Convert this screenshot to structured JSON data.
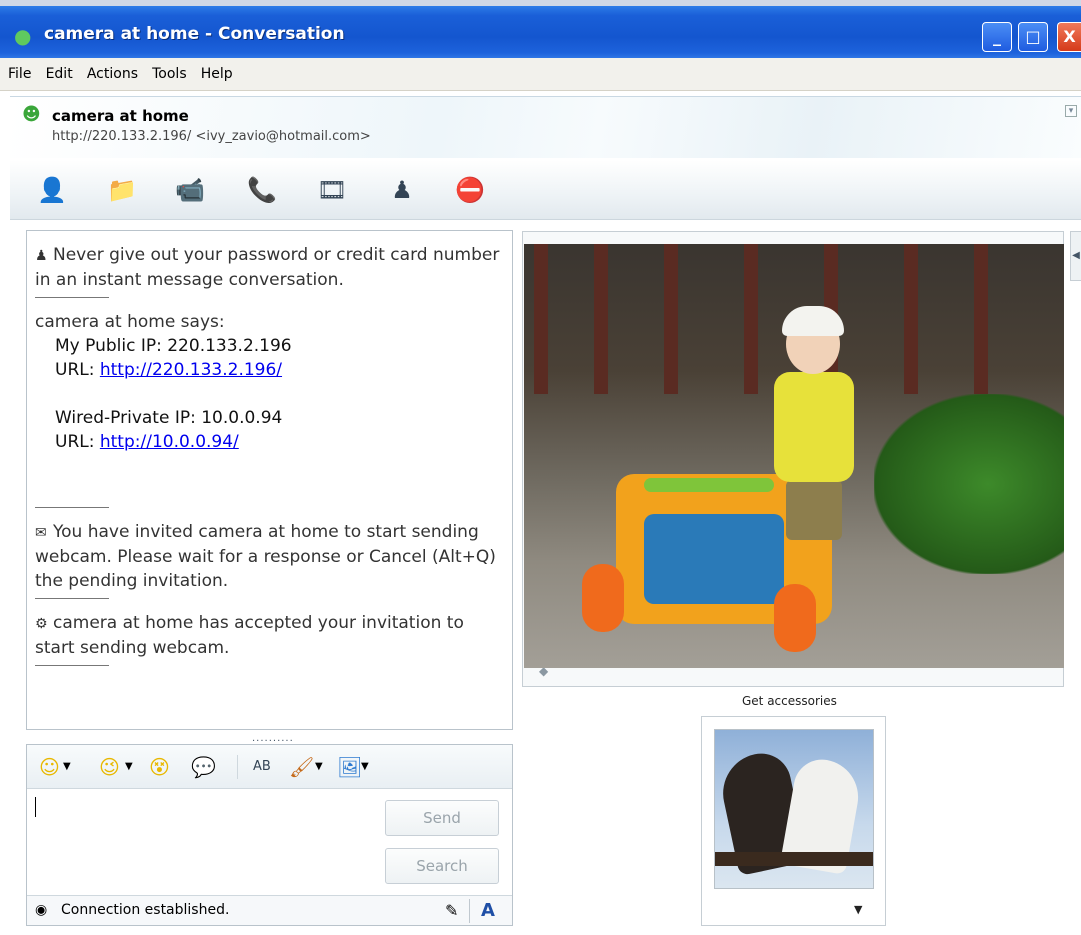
{
  "window": {
    "title": "camera at home - Conversation",
    "controls": {
      "minimize": "_",
      "maximize": "□",
      "close": "X"
    }
  },
  "menu": [
    "File",
    "Edit",
    "Actions",
    "Tools",
    "Help"
  ],
  "contact": {
    "name": "camera at home",
    "address": "http://220.133.2.196/ <ivy_zavio@hotmail.com>",
    "icon": "contact-online-icon"
  },
  "toolbar": [
    {
      "name": "invite-contact",
      "icon": "invite-contact-icon",
      "glyph": "👤"
    },
    {
      "name": "send-files",
      "icon": "send-files-icon",
      "glyph": "📁"
    },
    {
      "name": "start-webcam",
      "icon": "webcam-icon",
      "glyph": "📹"
    },
    {
      "name": "start-call",
      "icon": "phone-icon",
      "glyph": "📞"
    },
    {
      "name": "activities",
      "icon": "activities-icon",
      "glyph": "🎞"
    },
    {
      "name": "games",
      "icon": "games-icon",
      "glyph": "♟"
    },
    {
      "name": "block",
      "icon": "block-contact-icon",
      "glyph": "⛔"
    }
  ],
  "messages": {
    "warning": "Never give out your password or credit card number in an instant message conversation.",
    "sender": "camera at home says:",
    "public_ip": "My Public IP: 220.133.2.196",
    "url_label_1": "URL: ",
    "url_1": "http://220.133.2.196/",
    "private_ip": "Wired-Private IP: 10.0.0.94",
    "url_label_2": "URL: ",
    "url_2": "http://10.0.0.94/",
    "invite_notice": "You have invited camera at home to start sending webcam. Please wait for a response or Cancel (Alt+Q) the pending invitation.",
    "accepted_notice": "camera at home has accepted your invitation to start sending webcam."
  },
  "splitter": "..........",
  "compose": {
    "tools": [
      {
        "name": "emoticon",
        "glyph": "☺"
      },
      {
        "name": "wink",
        "glyph": "😉"
      },
      {
        "name": "nudge",
        "glyph": "😵"
      },
      {
        "name": "voice-clip",
        "glyph": "💬"
      },
      {
        "name": "font",
        "glyph": "AB"
      },
      {
        "name": "background",
        "glyph": "🖌"
      },
      {
        "name": "more",
        "glyph": "🖼"
      }
    ],
    "send_label": "Send",
    "search_label": "Search"
  },
  "status": {
    "text": "Connection established.",
    "font_glyph": "A"
  },
  "accessories": {
    "label": "Get accessories"
  },
  "colors": {
    "titlebar": "#1456cf",
    "link": "#0000ee",
    "font_button": "#1f4fa6"
  }
}
